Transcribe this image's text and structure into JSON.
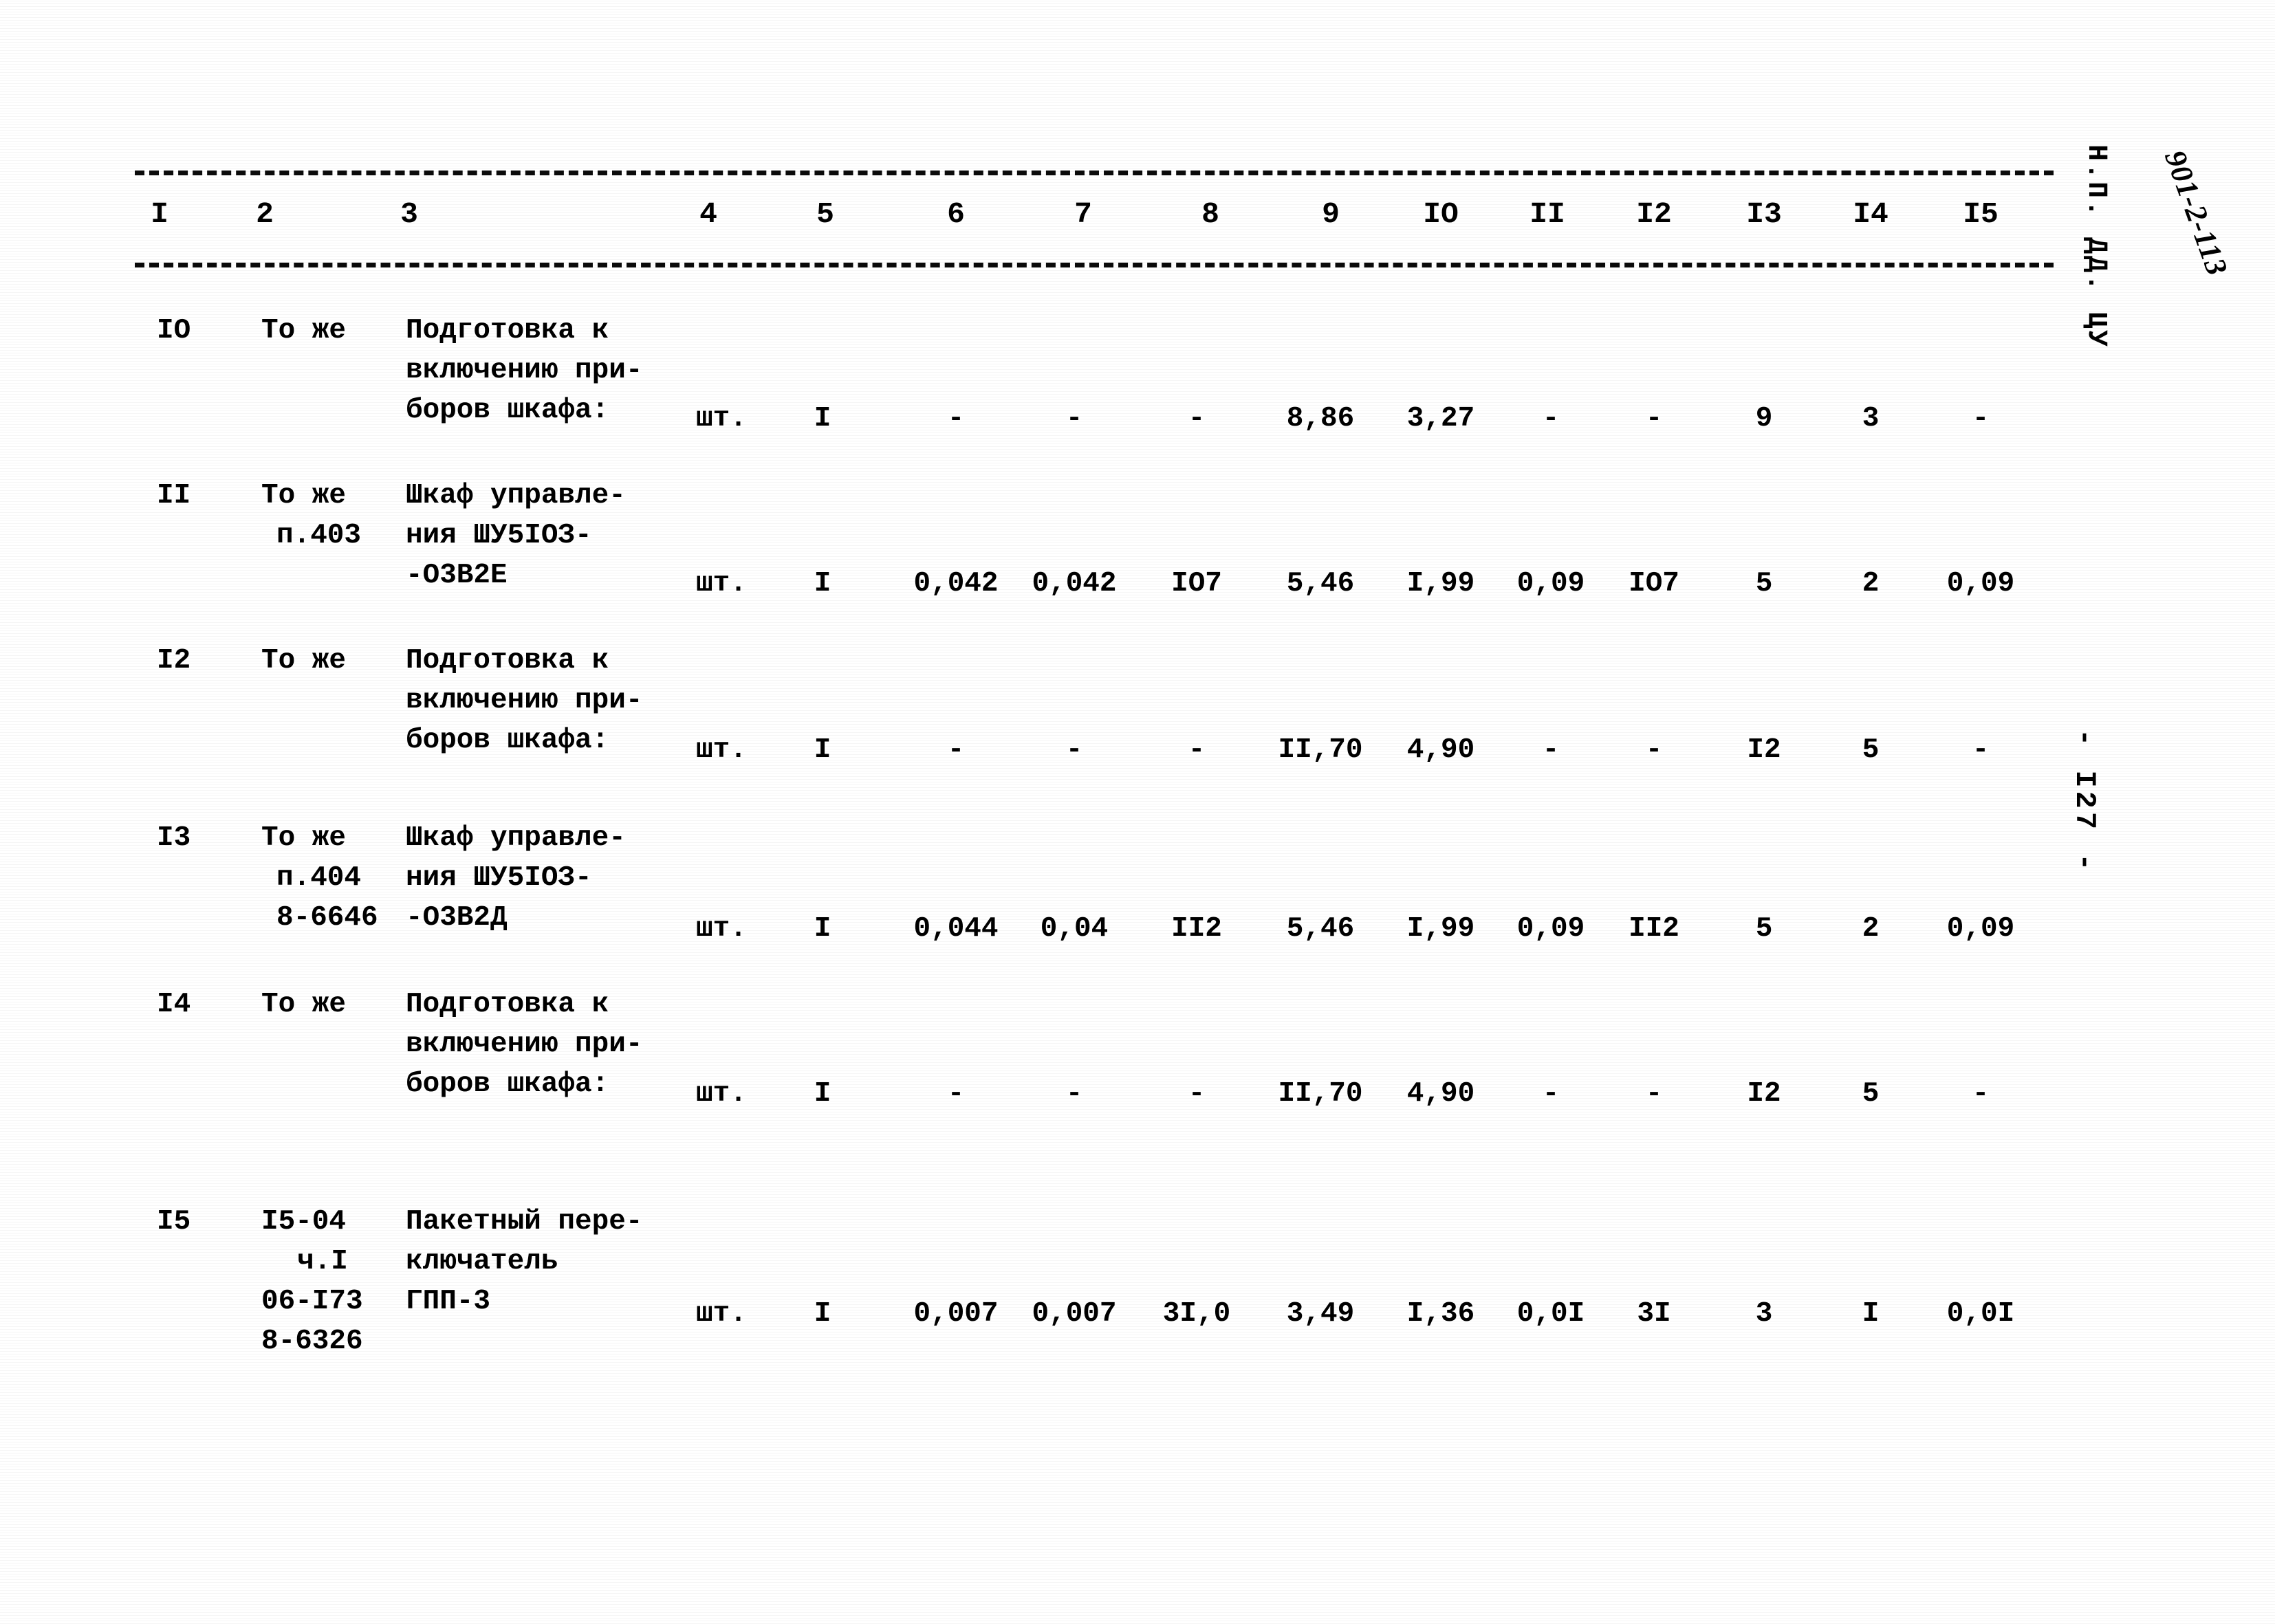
{
  "document": {
    "margin_code": "Н.П. ДД. ЦУ",
    "margin_handwritten": "901-2-113",
    "page_number": "- I27 -"
  },
  "table": {
    "column_numbers": [
      "I",
      "2",
      "3",
      "4",
      "5",
      "6",
      "7",
      "8",
      "9",
      "IO",
      "II",
      "I2",
      "I3",
      "I4",
      "I5"
    ],
    "rows": [
      {
        "num": "IO",
        "ref_lines": [
          "То же"
        ],
        "name_lines": [
          "Подготовка к",
          "включению при-",
          "боров шкафа:"
        ],
        "unit": "шт.",
        "c5": "I",
        "c6": "-",
        "c7": "-",
        "c8": "-",
        "c9": "8,86",
        "c10": "3,27",
        "c11": "-",
        "c12": "-",
        "c13": "9",
        "c14": "3",
        "c15": "-"
      },
      {
        "num": "II",
        "ref_lines": [
          "То же",
          "п.403"
        ],
        "name_lines": [
          "Шкаф управле-",
          "ния ШУ5IОЗ-",
          "-О3В2Е"
        ],
        "unit": "шт.",
        "c5": "I",
        "c6": "0,042",
        "c7": "0,042",
        "c8": "IO7",
        "c9": "5,46",
        "c10": "I,99",
        "c11": "0,09",
        "c12": "IO7",
        "c13": "5",
        "c14": "2",
        "c15": "0,09"
      },
      {
        "num": "I2",
        "ref_lines": [
          "То же"
        ],
        "name_lines": [
          "Подготовка к",
          "включению при-",
          "боров шкафа:"
        ],
        "unit": "шт.",
        "c5": "I",
        "c6": "-",
        "c7": "-",
        "c8": "-",
        "c9": "II,70",
        "c10": "4,90",
        "c11": "-",
        "c12": "-",
        "c13": "I2",
        "c14": "5",
        "c15": "-"
      },
      {
        "num": "I3",
        "ref_lines": [
          "То же",
          "п.404",
          "8-6646"
        ],
        "name_lines": [
          "Шкаф управле-",
          "ния ШУ5IОЗ-",
          "-О3В2Д"
        ],
        "unit": "шт.",
        "c5": "I",
        "c6": "0,044",
        "c7": "0,04",
        "c8": "II2",
        "c9": "5,46",
        "c10": "I,99",
        "c11": "0,09",
        "c12": "II2",
        "c13": "5",
        "c14": "2",
        "c15": "0,09"
      },
      {
        "num": "I4",
        "ref_lines": [
          "То же"
        ],
        "name_lines": [
          "Подготовка к",
          "включению при-",
          "боров шкафа:"
        ],
        "unit": "шт.",
        "c5": "I",
        "c6": "-",
        "c7": "-",
        "c8": "-",
        "c9": "II,70",
        "c10": "4,90",
        "c11": "-",
        "c12": "-",
        "c13": "I2",
        "c14": "5",
        "c15": "-"
      },
      {
        "num": "I5",
        "ref_lines": [
          "I5-04",
          "ч.I",
          "06-I73",
          "8-6326"
        ],
        "name_lines": [
          "Пакетный пере-",
          "ключатель",
          "ГПП-3"
        ],
        "unit": "шт.",
        "c5": "I",
        "c6": "0,007",
        "c7": "0,007",
        "c8": "3I,0",
        "c9": "3,49",
        "c10": "I,36",
        "c11": "0,0I",
        "c12": "3I",
        "c13": "3",
        "c14": "I",
        "c15": "0,0I"
      }
    ]
  }
}
